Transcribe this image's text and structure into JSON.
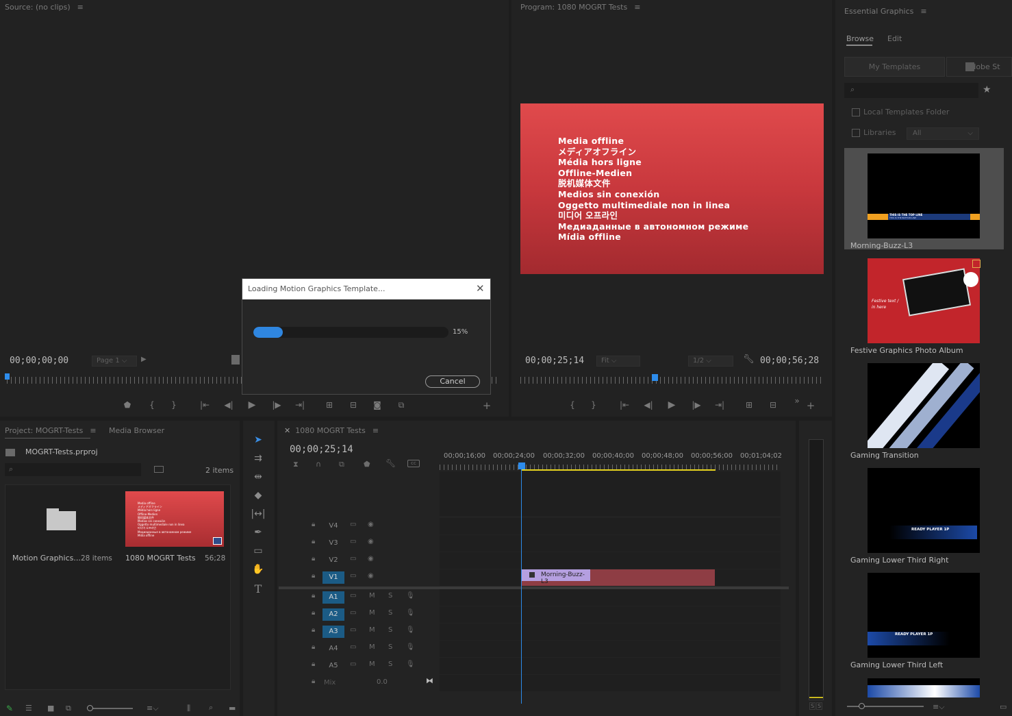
{
  "source": {
    "title": "Source: (no clips)",
    "timecode": "00;00;00;00",
    "page": "Page 1"
  },
  "program": {
    "title": "Program: 1080 MOGRT Tests",
    "timecode_left": "00;00;25;14",
    "fit": "Fit",
    "resolution": "1/2",
    "timecode_right": "00;00;56;28",
    "offline_lines": [
      "Media offline",
      "メディアオフライン",
      "Média hors ligne",
      "Offline-Medien",
      "脱机媒体文件",
      "Medios sin conexión",
      "Oggetto multimediale non in linea",
      "미디어 오프라인",
      "Медиаданные в автономном режиме",
      "Mídia offline"
    ]
  },
  "dialog": {
    "title": "Loading Motion Graphics Template...",
    "progress": 0.15,
    "progress_label": "15%",
    "cancel": "Cancel"
  },
  "project": {
    "tab_project": "Project: MOGRT-Tests",
    "tab_media": "Media Browser",
    "file": "MOGRT-Tests.prproj",
    "count": "2 items",
    "items": [
      {
        "name": "Motion Graphics...",
        "meta": "28 items"
      },
      {
        "name": "1080 MOGRT Tests",
        "meta": "56;28"
      }
    ]
  },
  "timeline": {
    "tab": "1080 MOGRT Tests",
    "timecode": "00;00;25;14",
    "ruler": [
      "00;00;16;00",
      "00;00;24;00",
      "00;00;32;00",
      "00;00;40;00",
      "00;00;48;00",
      "00;00;56;00",
      "00;01;04;02"
    ],
    "video_tracks": [
      "V4",
      "V3",
      "V2",
      "V1"
    ],
    "audio_tracks": [
      "A1",
      "A2",
      "A3",
      "A4",
      "A5"
    ],
    "mix_label": "Mix",
    "mix_value": "0.0",
    "clip": "Morning-Buzz-L3"
  },
  "eg": {
    "title": "Essential Graphics",
    "tab_browse": "Browse",
    "tab_edit": "Edit",
    "my_templates": "My Templates",
    "adobe_stock": "Adobe St",
    "local_folder": "Local Templates Folder",
    "libraries": "Libraries",
    "libraries_value": "All",
    "thumb_top_line": "THIS IS THE TOP LINE",
    "thumb_bottom_line": "THIS IS THE BOTTOM LINE",
    "photo_album_text": "Festive text / in here",
    "ready_player": "READY PLAYER 1P",
    "templates": [
      "Morning-Buzz-L3",
      "Festive Graphics Photo Album",
      "Gaming Transition",
      "Gaming Lower Third Right",
      "Gaming Lower Third Left"
    ]
  },
  "meters": {
    "s1": "S",
    "s2": "S"
  }
}
